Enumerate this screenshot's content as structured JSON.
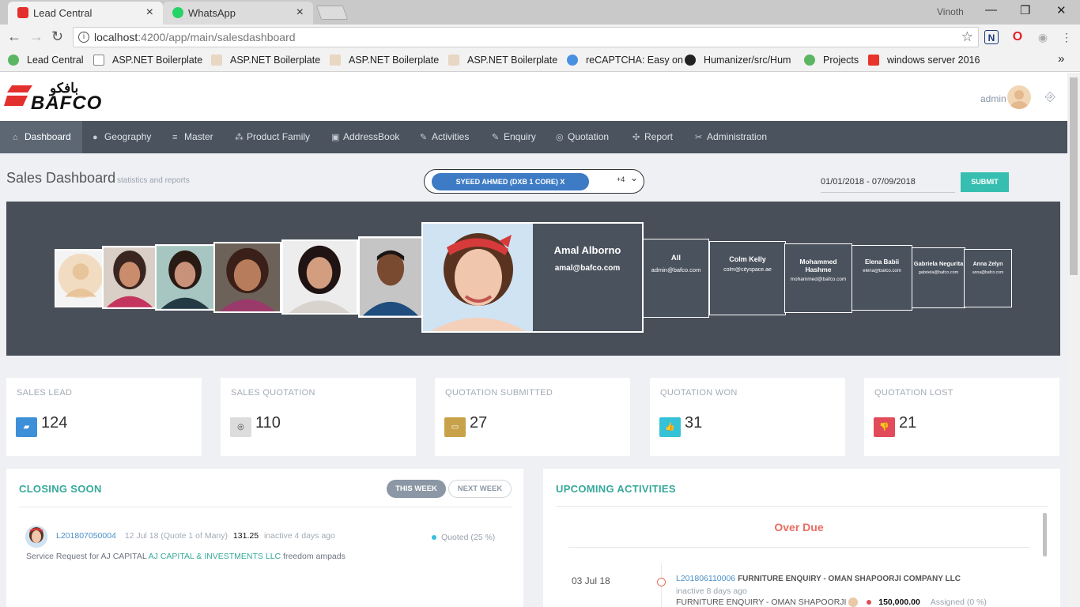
{
  "browser": {
    "tabs": [
      {
        "title": "Lead Central",
        "close": "×"
      },
      {
        "title": "WhatsApp",
        "close": "×"
      }
    ],
    "window_user": "Vinoth",
    "controls": {
      "minimize": "—",
      "restore": "❐",
      "close": "✕"
    },
    "url_host": "localhost",
    "url_rest": ":4200/app/main/salesdashboard",
    "bookmarks": [
      "Lead Central",
      "ASP.NET Boilerplate",
      "ASP.NET Boilerplate",
      "ASP.NET Boilerplate",
      "ASP.NET Boilerplate",
      "reCAPTCHA: Easy on",
      "Humanizer/src/Hum",
      "Projects",
      "windows server 2016"
    ],
    "bookmarks_more": "»"
  },
  "header": {
    "logo_arabic": "بافكو",
    "logo_text": "BAFCO",
    "user": "admin"
  },
  "menu": [
    {
      "label": "Dashboard",
      "icon": "⌂"
    },
    {
      "label": "Geography",
      "icon": "●"
    },
    {
      "label": "Master",
      "icon": "≡"
    },
    {
      "label": "Product Family",
      "icon": "⁂"
    },
    {
      "label": "AddressBook",
      "icon": "▣"
    },
    {
      "label": "Activities",
      "icon": "✎"
    },
    {
      "label": "Enquiry",
      "icon": "✎"
    },
    {
      "label": "Quotation",
      "icon": "◎"
    },
    {
      "label": "Report",
      "icon": "✣"
    },
    {
      "label": "Administration",
      "icon": "✂"
    }
  ],
  "page": {
    "title": "Sales Dashboard",
    "subtitle": "statistics and reports",
    "selected_user": "SYEED AHMED (DXB 1 CORE) X",
    "more_count": "+4",
    "date_range": "01/01/2018 - 07/09/2018",
    "submit": "SUBMIT"
  },
  "carousel": {
    "featured": {
      "name": "Amal Alborno",
      "email": "amal@bafco.com"
    },
    "others": [
      {
        "name": "All",
        "email": "admin@bafco.com"
      },
      {
        "name": "Colm Kelly",
        "email": "colm@cityspace.ae"
      },
      {
        "name": "Mohammed Hashme",
        "email": "mohammed@bafco.com"
      },
      {
        "name": "Elena Babii",
        "email": "elena@bafco.com"
      },
      {
        "name": "Gabriela Negurita",
        "email": "gabriela@bafco.com"
      },
      {
        "name": "Anna Zelyn",
        "email": "anna@bafco.com"
      }
    ]
  },
  "stats": [
    {
      "label": "SALES LEAD",
      "value": "124",
      "icon": "▰",
      "color": "#3d8fd8"
    },
    {
      "label": "SALES QUOTATION",
      "value": "110",
      "icon": "◎",
      "color": "#dcdcdc"
    },
    {
      "label": "QUOTATION SUBMITTED",
      "value": "27",
      "icon": "▭",
      "color": "#c8a24a"
    },
    {
      "label": "QUOTATION WON",
      "value": "31",
      "icon": "👍",
      "color": "#36c2d6"
    },
    {
      "label": "QUOTATION LOST",
      "value": "21",
      "icon": "👎",
      "color": "#e24c5a"
    }
  ],
  "closing_soon": {
    "title": "CLOSING SOON",
    "this_week": "THIS WEEK",
    "next_week": "NEXT WEEK",
    "item": {
      "id": "L201807050004",
      "meta": "12 Jul 18 (Quote 1 of Many)",
      "amount": "131.25",
      "inactive": "inactive 4 days ago",
      "desc_prefix": "Service Request for AJ CAPITAL",
      "company": "AJ CAPITAL & INVESTMENTS LLC",
      "desc_suffix": "freedom ampads",
      "status": "Quoted (25 %)"
    }
  },
  "upcoming": {
    "title": "UPCOMING ACTIVITIES",
    "section": "Over Due",
    "item": {
      "date": "03 Jul 18",
      "id": "L201806110006",
      "title": "FURNITURE ENQUIRY - OMAN SHAPOORJI COMPANY LLC",
      "inactive": "inactive 8 days ago",
      "subtitle": "FURNITURE ENQUIRY - OMAN SHAPOORJI",
      "amount": "150,000.00",
      "status": "Assigned (0 %)"
    }
  }
}
